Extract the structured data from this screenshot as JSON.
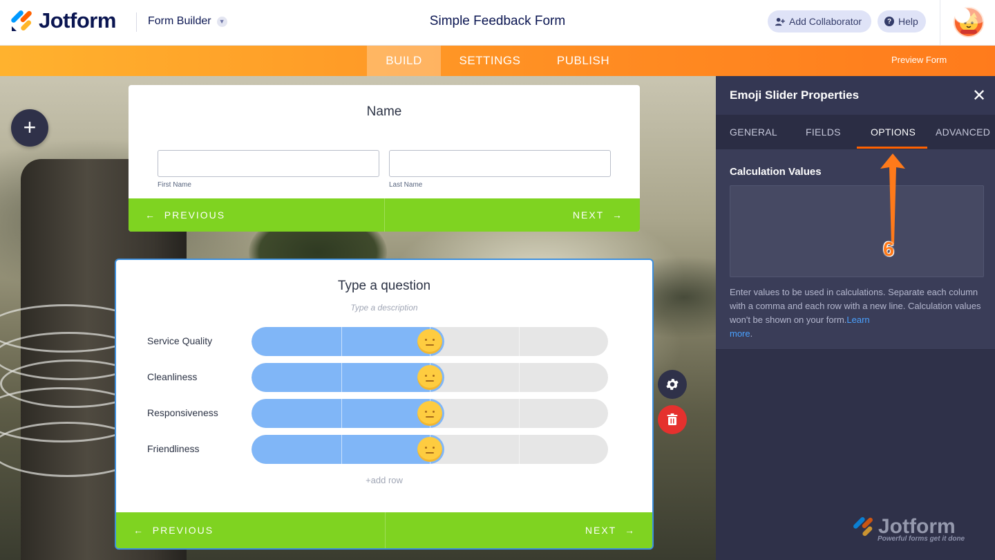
{
  "header": {
    "logo_text": "Jotform",
    "builder_label": "Form Builder",
    "form_title": "Simple Feedback Form",
    "add_collaborator": "Add Collaborator",
    "help": "Help"
  },
  "nav": {
    "tabs": [
      "BUILD",
      "SETTINGS",
      "PUBLISH"
    ],
    "active_tab": "BUILD",
    "preview_label": "Preview Form",
    "preview_on": false
  },
  "name_card": {
    "title": "Name",
    "first_label": "First Name",
    "last_label": "Last Name",
    "first_value": "",
    "last_value": "",
    "prev": "PREVIOUS",
    "next": "NEXT"
  },
  "question_card": {
    "title": "Type a question",
    "description_placeholder": "Type a description",
    "rows": [
      {
        "label": "Service Quality",
        "level": 0.5
      },
      {
        "label": "Cleanliness",
        "level": 0.5
      },
      {
        "label": "Responsiveness",
        "level": 0.5
      },
      {
        "label": "Friendliness",
        "level": 0.5
      }
    ],
    "add_row": "+add row",
    "prev": "PREVIOUS",
    "next": "NEXT"
  },
  "panel": {
    "title": "Emoji Slider Properties",
    "tabs": [
      "GENERAL",
      "FIELDS",
      "OPTIONS",
      "ADVANCED"
    ],
    "active_tab": "OPTIONS",
    "calc_label": "Calculation Values",
    "calc_value": "",
    "help_text": "Enter values to be used in calculations. Separate each column with a comma and each row with a new line. Calculation values won't be shown on your form.",
    "help_link_1": "Learn",
    "help_link_2": "more",
    "help_period": "."
  },
  "annotation": {
    "step": "6",
    "color": "#ff7a1a"
  },
  "watermark": {
    "text": "Jotform",
    "tagline": "Powerful forms get it done"
  },
  "colors": {
    "brand_orange": "#ff8c22",
    "green": "#7fd321",
    "slider_fill": "#80b6f7",
    "panel_bg": "#2f3149",
    "selected_border": "#3b8ede"
  },
  "icons": {
    "add": "plus-icon",
    "gear": "gear-icon",
    "trash": "trash-icon",
    "close": "close-icon",
    "help": "question-icon",
    "collaborator": "user-plus-icon"
  }
}
